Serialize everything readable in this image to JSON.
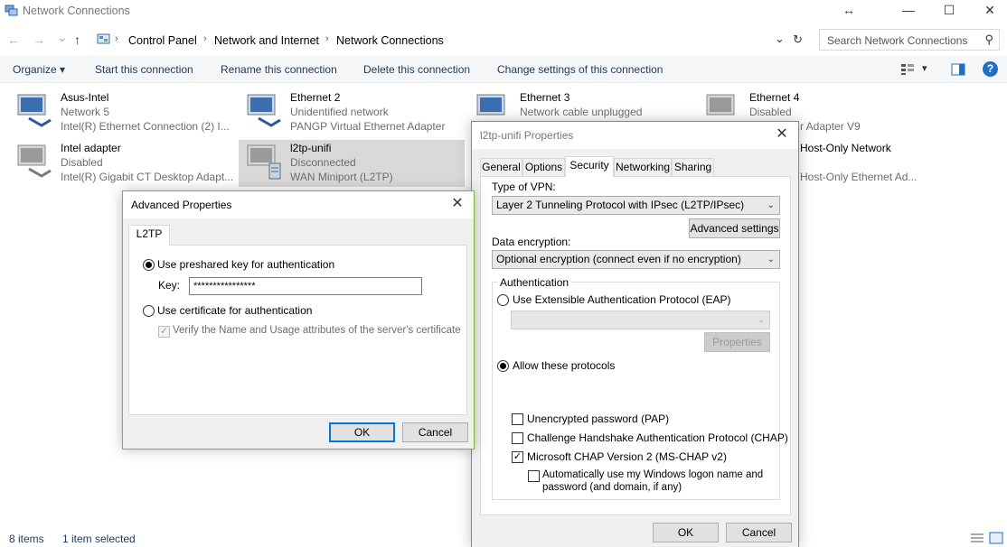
{
  "window": {
    "title": "Network Connections",
    "resize_glyph": "↔",
    "minimize_glyph": "—",
    "maximize_glyph": "☐",
    "close_glyph": "✕"
  },
  "address": {
    "back_glyph": "←",
    "forward_glyph": "→",
    "recent_glyph": "⌄",
    "up_glyph": "↑",
    "crumbs": [
      "Control Panel",
      "Network and Internet",
      "Network Connections"
    ],
    "separator": "›",
    "dropdown_glyph": "⌄",
    "refresh_glyph": "↻",
    "search_placeholder": "Search Network Connections",
    "search_glyph": "⚲"
  },
  "toolbar": {
    "organize": "Organize ▾",
    "commands": [
      "Start this connection",
      "Rename this connection",
      "Delete this connection",
      "Change settings of this connection"
    ],
    "view_glyph": "▾",
    "help_glyph": "?"
  },
  "items": [
    {
      "name": "Asus-Intel",
      "status": "Network  5",
      "device": "Intel(R) Ethernet Connection (2) I..."
    },
    {
      "name": "Ethernet 2",
      "status": "Unidentified network",
      "device": "PANGP Virtual Ethernet Adapter"
    },
    {
      "name": "Ethernet 3",
      "status": "Network cable unplugged",
      "device": ""
    },
    {
      "name": "Ethernet 4",
      "status": "Disabled",
      "device": "r Adapter V9"
    },
    {
      "name": "Intel adapter",
      "status": "Disabled",
      "device": "Intel(R) Gigabit CT Desktop Adapt..."
    },
    {
      "name": "l2tp-unifi",
      "status": "Disconnected",
      "device": "WAN Miniport (L2TP)"
    },
    {
      "name": "Host-Only Network",
      "status": "",
      "device": "Host-Only Ethernet Ad..."
    }
  ],
  "status": {
    "count": "8 items",
    "selected": "1 item selected"
  },
  "properties_dialog": {
    "title": "l2tp-unifi Properties",
    "tabs": [
      "General",
      "Options",
      "Security",
      "Networking",
      "Sharing"
    ],
    "vpn_type_label": "Type of VPN:",
    "vpn_type_value": "Layer 2 Tunneling Protocol with IPsec (L2TP/IPsec)",
    "advanced_settings": "Advanced settings",
    "encryption_label": "Data encryption:",
    "encryption_value": "Optional encryption (connect even if no encryption)",
    "auth_group": "Authentication",
    "eap_label": "Use Extensible Authentication Protocol (EAP)",
    "eap_combo_value": "",
    "properties_button": "Properties",
    "allow_label": "Allow these protocols",
    "pap": "Unencrypted password (PAP)",
    "chap": "Challenge Handshake Authentication Protocol (CHAP)",
    "mschap": "Microsoft CHAP Version 2 (MS-CHAP v2)",
    "auto_logon_line1": "Automatically use my Windows logon name and",
    "auto_logon_line2": "password (and domain, if any)",
    "ok": "OK",
    "cancel": "Cancel",
    "close_glyph": "✕",
    "arrow_glyph": "⌄",
    "check_glyph": "✓"
  },
  "advanced_dialog": {
    "title": "Advanced Properties",
    "tab": "L2TP",
    "preshared_label": "Use preshared key for authentication",
    "key_label": "Key:",
    "key_value": "****************",
    "certificate_label": "Use certificate for authentication",
    "verify_label": "Verify the Name and Usage attributes of the server's certificate",
    "ok": "OK",
    "cancel": "Cancel",
    "close_glyph": "✕",
    "check_glyph": "✓"
  }
}
